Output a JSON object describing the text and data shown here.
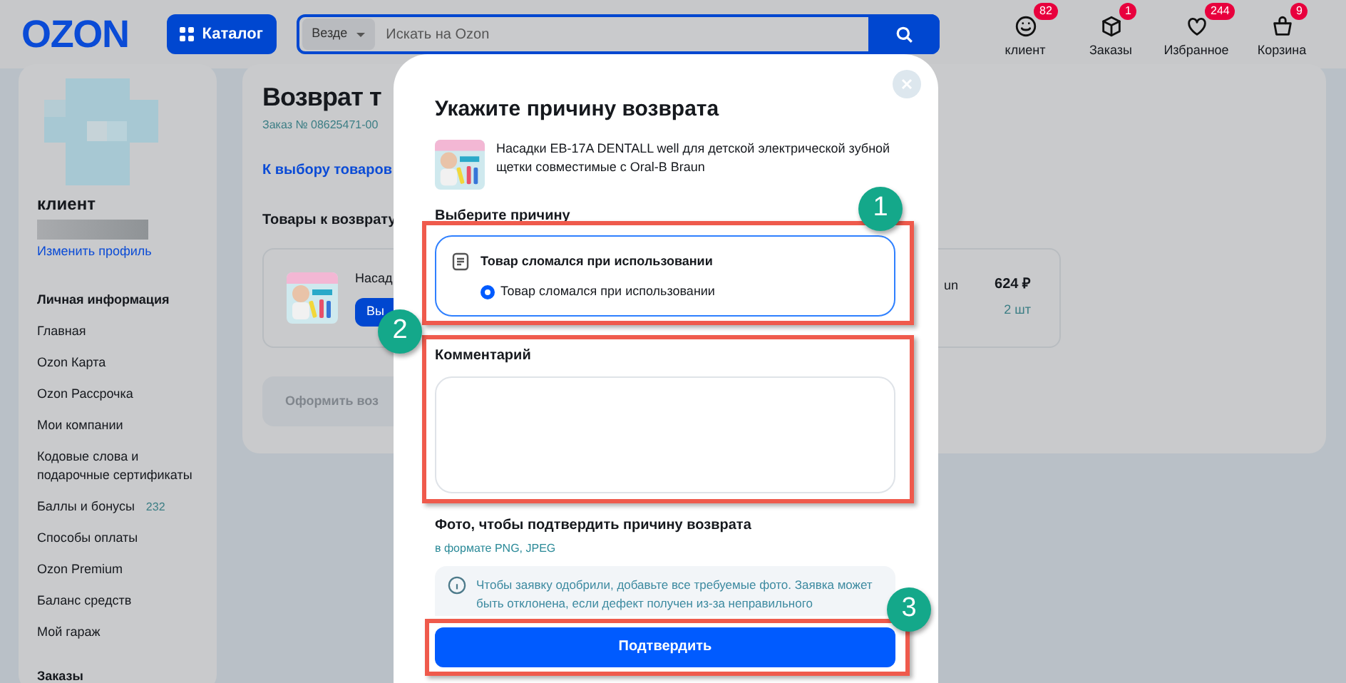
{
  "header": {
    "logo": "OZON",
    "catalog_button": "Каталог",
    "search": {
      "scope": "Везде",
      "placeholder": "Искать на Ozon"
    },
    "nav": [
      {
        "label": "клиент",
        "badge": "82",
        "kind": "face"
      },
      {
        "label": "Заказы",
        "badge": "1",
        "kind": "box"
      },
      {
        "label": "Избранное",
        "badge": "244",
        "kind": "heart"
      },
      {
        "label": "Корзина",
        "badge": "9",
        "kind": "bag"
      }
    ]
  },
  "sidebar": {
    "user_name": "клиент",
    "edit_link": "Изменить профиль",
    "section": "Личная информация",
    "items": [
      {
        "label": "Главная"
      },
      {
        "label": "Ozon Карта"
      },
      {
        "label": "Ozon Рассрочка"
      },
      {
        "label": "Мои компании"
      },
      {
        "label": "Кодовые слова и подарочные сертификаты"
      },
      {
        "label": "Баллы и бонусы",
        "count": "232"
      },
      {
        "label": "Способы оплаты"
      },
      {
        "label": "Ozon Premium"
      },
      {
        "label": "Баланс средств"
      },
      {
        "label": "Мой гараж"
      }
    ],
    "section_2": "Заказы"
  },
  "main": {
    "title": "Возврат т",
    "order": "Заказ № 08625471-00",
    "back_link": "К выбору товаров",
    "items_heading": "Товары к возврату",
    "product": {
      "name": "Насад",
      "button": "Вы",
      "name_tail": "un",
      "price": "624 ₽",
      "quantity": "2 шт"
    },
    "submit_button": "Оформить воз"
  },
  "modal": {
    "title": "Укажите причину возврата",
    "product": "Насадки EB-17A DENTALL well для детской электрической зубной щетки совместимые с Oral-B Braun",
    "reason_label": "Выберите причину",
    "reason": {
      "title": "Товар сломался при использовании",
      "options": [
        {
          "label": "Товар сломался при использовании",
          "selected": true
        }
      ]
    },
    "comment_label": "Комментарий",
    "photo_label": "Фото, чтобы подтвердить причину возврата",
    "photo_hint": "в формате PNG, JPEG",
    "info_lines": [
      "Чтобы заявку одобрили, добавьте все требуемые фото. Заявка может",
      "быть отклонена, если дефект получен из-за неправильного"
    ],
    "confirm_button": "Подтвердить"
  },
  "annotations": [
    "1",
    "2",
    "3"
  ]
}
